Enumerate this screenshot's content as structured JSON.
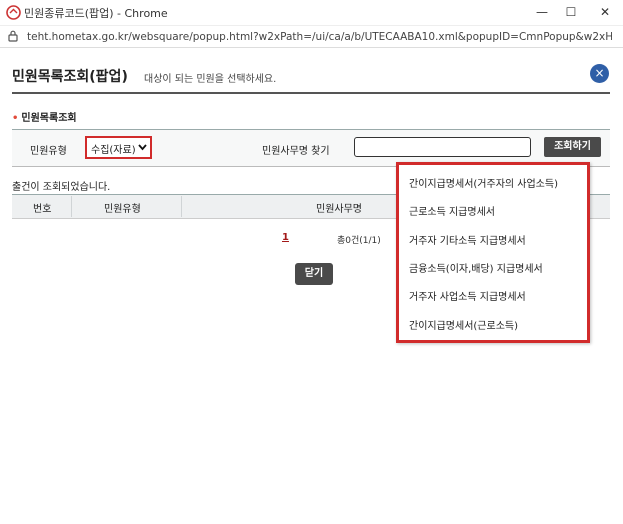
{
  "window": {
    "title": "민원종류코드(팝업) - Chrome",
    "minimize_glyph": "—",
    "maximize_glyph": "☐",
    "close_glyph": "✕"
  },
  "address": {
    "url": "teht.hometax.go.kr/websquare/popup.html?w2xPath=/ui/ca/a/b/UTECAABA10.xml&popupID=CmnPopup&w2xHo..."
  },
  "popup": {
    "title": "민원목록조회(팝업)",
    "subtitle": "대상이 되는 민원을 선택하세요.",
    "close_glyph": "×"
  },
  "section": {
    "bullet": "•",
    "title": "민원목록조회"
  },
  "search": {
    "type_label": "민원유형",
    "type_selected": "수집(자료)",
    "type_arrow": "⌄",
    "office_label": "민원사무명 찾기",
    "office_value": "",
    "search_button": "조회하기"
  },
  "result": {
    "message": "출건이 조회되었습니다."
  },
  "table": {
    "columns": [
      "번호",
      "민원유형",
      "민원사무명"
    ]
  },
  "pager": {
    "current": "1",
    "total": "총0건(1/1)"
  },
  "close_button": "닫기",
  "dropdown": {
    "options": [
      "간이지급명세서(거주자의 사업소득)",
      "근로소득 지급명세서",
      "거주자 기타소득 지급명세서",
      "금융소득(이자,배당) 지급명세서",
      "거주자 사업소득 지급명세서",
      "간이지급명세서(근로소득)"
    ]
  },
  "colors": {
    "accent_blue": "#2f5fa7",
    "highlight_red": "#d12b2b",
    "button_dark": "#4a4a4a"
  }
}
